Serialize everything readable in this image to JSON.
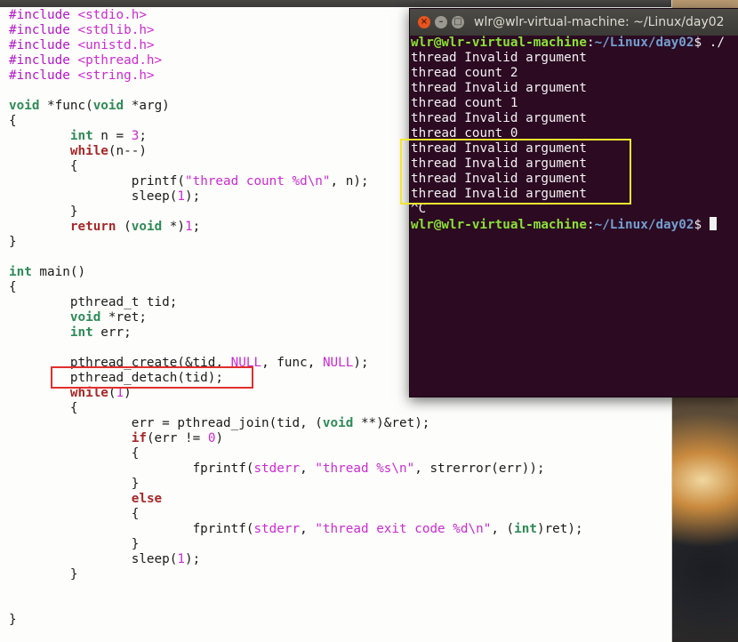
{
  "editor": {
    "lines": [
      [
        {
          "c": "pp",
          "t": "#include "
        },
        {
          "c": "str",
          "t": "<stdio.h>"
        }
      ],
      [
        {
          "c": "pp",
          "t": "#include "
        },
        {
          "c": "str",
          "t": "<stdlib.h>"
        }
      ],
      [
        {
          "c": "pp",
          "t": "#include "
        },
        {
          "c": "str",
          "t": "<unistd.h>"
        }
      ],
      [
        {
          "c": "pp",
          "t": "#include "
        },
        {
          "c": "str",
          "t": "<pthread.h>"
        }
      ],
      [
        {
          "c": "pp",
          "t": "#include "
        },
        {
          "c": "str",
          "t": "<string.h>"
        }
      ],
      [],
      [
        {
          "c": "kw",
          "t": "void"
        },
        {
          "t": " *func("
        },
        {
          "c": "kw",
          "t": "void"
        },
        {
          "t": " *arg)"
        }
      ],
      [
        {
          "t": "{"
        }
      ],
      [
        {
          "t": "        "
        },
        {
          "c": "kw",
          "t": "int"
        },
        {
          "t": " n = "
        },
        {
          "c": "num",
          "t": "3"
        },
        {
          "t": ";"
        }
      ],
      [
        {
          "t": "        "
        },
        {
          "c": "kw2",
          "t": "while"
        },
        {
          "t": "(n--)"
        }
      ],
      [
        {
          "t": "        {"
        }
      ],
      [
        {
          "t": "                printf("
        },
        {
          "c": "str",
          "t": "\"thread count %d\\n\""
        },
        {
          "t": ", n);"
        }
      ],
      [
        {
          "t": "                sleep("
        },
        {
          "c": "num",
          "t": "1"
        },
        {
          "t": ");"
        }
      ],
      [
        {
          "t": "        }"
        }
      ],
      [
        {
          "t": "        "
        },
        {
          "c": "kw2",
          "t": "return"
        },
        {
          "t": " ("
        },
        {
          "c": "kw",
          "t": "void"
        },
        {
          "t": " *)"
        },
        {
          "c": "num",
          "t": "1"
        },
        {
          "t": ";"
        }
      ],
      [
        {
          "t": "}"
        }
      ],
      [],
      [
        {
          "c": "kw",
          "t": "int"
        },
        {
          "t": " main()"
        }
      ],
      [
        {
          "t": "{"
        }
      ],
      [
        {
          "t": "        pthread_t tid;"
        }
      ],
      [
        {
          "t": "        "
        },
        {
          "c": "kw",
          "t": "void"
        },
        {
          "t": " *ret;"
        }
      ],
      [
        {
          "t": "        "
        },
        {
          "c": "kw",
          "t": "int"
        },
        {
          "t": " err;"
        }
      ],
      [],
      [
        {
          "t": "        pthread_create(&tid, "
        },
        {
          "c": "num",
          "t": "NULL"
        },
        {
          "t": ", func, "
        },
        {
          "c": "num",
          "t": "NULL"
        },
        {
          "t": ");"
        }
      ],
      [
        {
          "t": "        pthread_detach(tid);"
        }
      ],
      [
        {
          "t": "        "
        },
        {
          "c": "kw2",
          "t": "while"
        },
        {
          "t": "("
        },
        {
          "c": "num",
          "t": "1"
        },
        {
          "t": ")"
        }
      ],
      [
        {
          "t": "        {"
        }
      ],
      [
        {
          "t": "                err = pthread_join(tid, ("
        },
        {
          "c": "kw",
          "t": "void"
        },
        {
          "t": " **)&ret);"
        }
      ],
      [
        {
          "t": "                "
        },
        {
          "c": "kw2",
          "t": "if"
        },
        {
          "t": "(err != "
        },
        {
          "c": "num",
          "t": "0"
        },
        {
          "t": ")"
        }
      ],
      [
        {
          "t": "                {"
        }
      ],
      [
        {
          "t": "                        fprintf("
        },
        {
          "c": "str",
          "t": "stderr"
        },
        {
          "t": ", "
        },
        {
          "c": "str",
          "t": "\"thread %s\\n\""
        },
        {
          "t": ", strerror(err));"
        }
      ],
      [
        {
          "t": "                }"
        }
      ],
      [
        {
          "t": "                "
        },
        {
          "c": "kw2",
          "t": "else"
        }
      ],
      [
        {
          "t": "                {"
        }
      ],
      [
        {
          "t": "                        fprintf("
        },
        {
          "c": "str",
          "t": "stderr"
        },
        {
          "t": ", "
        },
        {
          "c": "str",
          "t": "\"thread exit code %d\\n\""
        },
        {
          "t": ", ("
        },
        {
          "c": "kw",
          "t": "int"
        },
        {
          "t": ")ret);"
        }
      ],
      [
        {
          "t": "                }"
        }
      ],
      [
        {
          "t": "                sleep("
        },
        {
          "c": "num",
          "t": "1"
        },
        {
          "t": ");"
        }
      ],
      [
        {
          "t": "        }"
        }
      ],
      [],
      [],
      [
        {
          "t": "}"
        }
      ]
    ]
  },
  "terminal": {
    "title": "wlr@wlr-virtual-machine: ~/Linux/day02",
    "close_glyph": "×",
    "min_glyph": "–",
    "max_glyph": "□",
    "prompt_user": "wlr@wlr-virtual-machine",
    "prompt_sep": ":",
    "prompt_path": "~/Linux/day02",
    "prompt_dollar": "$ ",
    "first_command": "./",
    "output": [
      "thread Invalid argument",
      "thread count 2",
      "thread Invalid argument",
      "thread count 1",
      "thread Invalid argument",
      "thread count 0",
      "thread Invalid argument",
      "thread Invalid argument",
      "thread Invalid argument",
      "thread Invalid argument",
      "^C"
    ]
  },
  "colors": {
    "terminal_bg": "#2c0a22",
    "prompt_user": "#8ae234",
    "prompt_path": "#729fcf",
    "highlight_red": "#e0302e",
    "highlight_yellow": "#f5e62e"
  }
}
